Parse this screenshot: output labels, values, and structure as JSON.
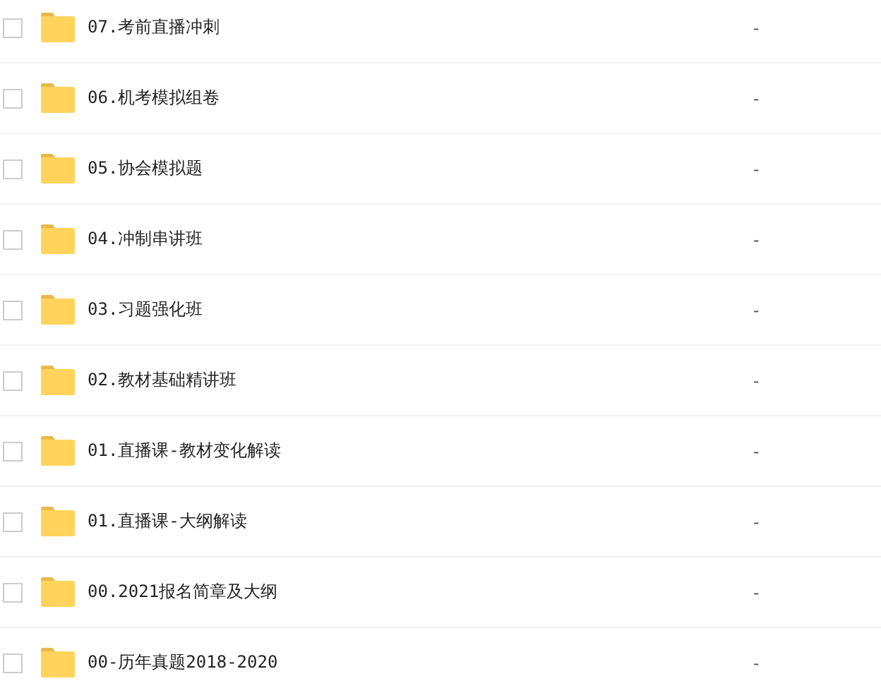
{
  "files": [
    {
      "name": "07.考前直播冲刺",
      "size": "-",
      "checked": false
    },
    {
      "name": "06.机考模拟组卷",
      "size": "-",
      "checked": false
    },
    {
      "name": "05.协会模拟题",
      "size": "-",
      "checked": false
    },
    {
      "name": "04.冲制串讲班",
      "size": "-",
      "checked": false
    },
    {
      "name": "03.习题强化班",
      "size": "-",
      "checked": false
    },
    {
      "name": "02.教材基础精讲班",
      "size": "-",
      "checked": false
    },
    {
      "name": "01.直播课-教材变化解读",
      "size": "-",
      "checked": false
    },
    {
      "name": "01.直播课-大纲解读",
      "size": "-",
      "checked": false
    },
    {
      "name": "00.2021报名简章及大纲",
      "size": "-",
      "checked": false
    },
    {
      "name": "00-历年真题2018-2020",
      "size": "-",
      "checked": false
    }
  ]
}
